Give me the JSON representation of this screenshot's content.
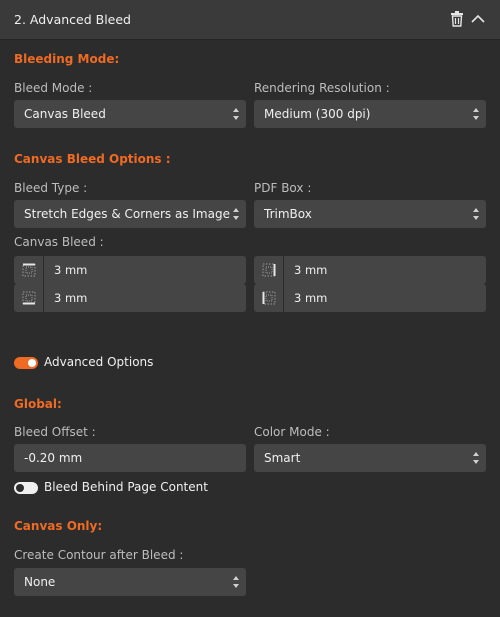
{
  "header": {
    "title": "2. Advanced Bleed",
    "delete_icon": "trash-icon",
    "collapse_icon": "chevron-up-icon"
  },
  "bleeding_mode": {
    "section_title": "Bleeding Mode:",
    "bleed_mode_label": "Bleed Mode :",
    "bleed_mode_value": "Canvas Bleed",
    "rendering_resolution_label": "Rendering Resolution :",
    "rendering_resolution_value": "Medium (300 dpi)"
  },
  "canvas_bleed_options": {
    "section_title": "Canvas Bleed Options :",
    "bleed_type_label": "Bleed Type :",
    "bleed_type_value": "Stretch Edges & Corners as Image",
    "pdf_box_label": "PDF Box :",
    "pdf_box_value": "TrimBox",
    "canvas_bleed_label": "Canvas Bleed :",
    "top": "3 mm",
    "right": "3 mm",
    "bottom": "3 mm",
    "left": "3 mm"
  },
  "advanced_options": {
    "label": "Advanced Options",
    "enabled": true
  },
  "global": {
    "section_title": "Global:",
    "bleed_offset_label": "Bleed Offset :",
    "bleed_offset_value": "-0.20 mm",
    "color_mode_label": "Color Mode :",
    "color_mode_value": "Smart",
    "bleed_behind_label": "Bleed Behind Page Content",
    "bleed_behind_enabled": false
  },
  "canvas_only": {
    "section_title": "Canvas Only:",
    "create_contour_label": "Create Contour after Bleed :",
    "create_contour_value": "None"
  },
  "colors": {
    "accent": "#ef6a23",
    "panel_bg": "#2c2c2c",
    "header_bg": "#3a3a3a",
    "field_bg": "#454545"
  }
}
